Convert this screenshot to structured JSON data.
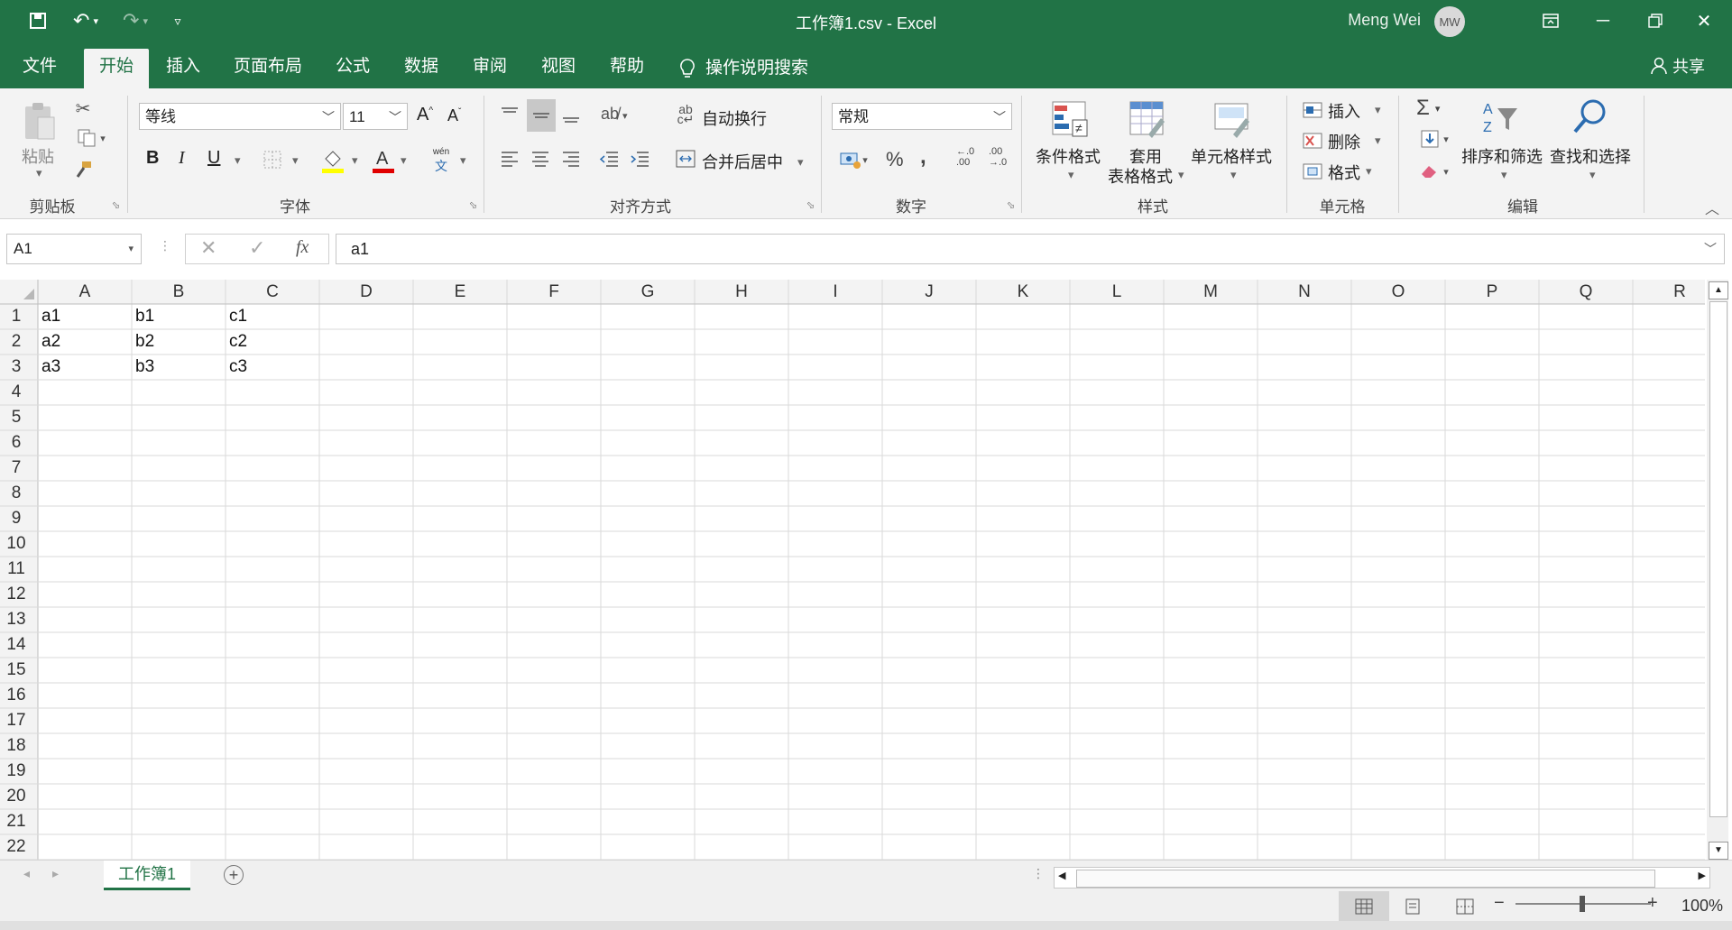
{
  "window": {
    "title": "工作簿1.csv  -  Excel",
    "user": "Meng Wei",
    "avatar_initials": "MW"
  },
  "tabs": [
    "文件",
    "开始",
    "插入",
    "页面布局",
    "公式",
    "数据",
    "审阅",
    "视图",
    "帮助"
  ],
  "active_tab": "开始",
  "tell_me": "操作说明搜索",
  "share": "共享",
  "ribbon": {
    "clipboard": {
      "paste": "粘贴",
      "label": "剪贴板"
    },
    "font": {
      "name": "等线",
      "size": "11",
      "label": "字体",
      "phonetic": "wén"
    },
    "alignment": {
      "wrap": "自动换行",
      "merge": "合并后居中",
      "label": "对齐方式"
    },
    "number": {
      "format": "常规",
      "label": "数字"
    },
    "styles": {
      "conditional": "条件格式",
      "table_line1": "套用",
      "table_line2": "表格格式",
      "cell_styles": "单元格样式",
      "label": "样式"
    },
    "cells": {
      "insert": "插入",
      "delete": "删除",
      "format": "格式",
      "label": "单元格"
    },
    "editing": {
      "sort": "排序和筛选",
      "find": "查找和选择",
      "label": "编辑"
    }
  },
  "formula_bar": {
    "name_box": "A1",
    "content": "a1",
    "fx": "fx"
  },
  "columns": [
    "A",
    "B",
    "C",
    "D",
    "E",
    "F",
    "G",
    "H",
    "I",
    "J",
    "K",
    "L",
    "M",
    "N",
    "O",
    "P",
    "Q",
    "R"
  ],
  "rows": [
    "1",
    "2",
    "3",
    "4",
    "5",
    "6",
    "7",
    "8",
    "9",
    "10",
    "11",
    "12",
    "13",
    "14",
    "15",
    "16",
    "17",
    "18",
    "19",
    "20",
    "21",
    "22"
  ],
  "cells": [
    [
      "a1",
      "b1",
      "c1"
    ],
    [
      "a2",
      "b2",
      "c2"
    ],
    [
      "a3",
      "b3",
      "c3"
    ]
  ],
  "sheet_tab": "工作簿1",
  "status": {
    "zoom": "100%"
  },
  "colors": {
    "accent": "#217346",
    "ribbon_bg": "#f3f3f3"
  }
}
